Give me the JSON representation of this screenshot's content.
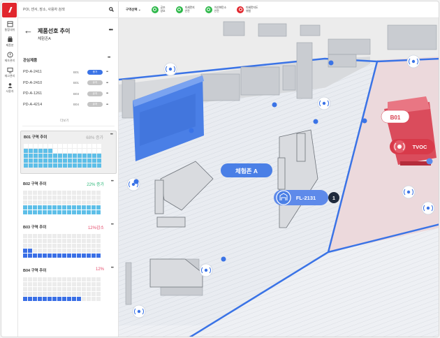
{
  "search": {
    "placeholder": "POI, 센서, 장소, 사용자 검색"
  },
  "rail": [
    {
      "name": "rail-item-dashboard",
      "icon": "dashboard-icon",
      "label": "통합대쉬"
    },
    {
      "name": "rail-item-products",
      "icon": "box-icon",
      "label": "제품분"
    },
    {
      "name": "rail-item-alerts",
      "icon": "alert-icon",
      "label": "제조관리"
    },
    {
      "name": "rail-item-monitor",
      "icon": "monitor-icon",
      "label": "재고관리"
    },
    {
      "name": "rail-item-users",
      "icon": "user-icon",
      "label": "사용자"
    }
  ],
  "header": {
    "back_icon": "arrow-left-icon",
    "title": "제품선호 추이",
    "subtitle": "체험존A"
  },
  "products": {
    "title": "관심제품",
    "items": [
      {
        "code": "PD-A-2411",
        "zone": "B01",
        "status": "증가",
        "color": "#3a73e6"
      },
      {
        "code": "PD-A-2410",
        "zone": "B01",
        "status": "유지",
        "color": "#c4c4c4"
      },
      {
        "code": "PD-A-1261",
        "zone": "B03",
        "status": "유지",
        "color": "#c4c4c4"
      },
      {
        "code": "PD-A-4214",
        "zone": "B04",
        "status": "유지",
        "color": "#c4c4c4"
      }
    ],
    "more": "더보기"
  },
  "zones": [
    {
      "title": "B01 구역 추이",
      "value": "68% 증가",
      "value_color": "#a8a8a8",
      "fill": 0.68,
      "fill_color": "#5ebfe8",
      "active": true
    },
    {
      "title": "B02 구역 추이",
      "value": "22% 증가",
      "value_color": "#2eb87a",
      "fill": 0.4,
      "fill_color": "#5ebfe8",
      "active": false
    },
    {
      "title": "B03 구역 추이",
      "value": "12%감소",
      "value_color": "#e54b6b",
      "fill": 0.22,
      "fill_color": "#3a6fe6",
      "active": false
    },
    {
      "title": "B04 구역 추이",
      "value": "12%",
      "value_color": "#e54b6b",
      "fill": 0.15,
      "fill_color": "#3a6fe6",
      "active": false
    }
  ],
  "topbar": {
    "zone_select": "구역선택",
    "status": [
      {
        "top": "공조",
        "bottom": "양호",
        "color": "#2eb84a"
      },
      {
        "top": "미세먼지",
        "bottom": "안전",
        "color": "#2eb84a"
      },
      {
        "top": "이산화탄소",
        "bottom": "안전",
        "color": "#2eb84a"
      },
      {
        "top": "미세먼지도",
        "bottom": "위험",
        "color": "#e1262d"
      }
    ]
  },
  "map": {
    "zone_label": "체험존 A",
    "b01_label": "B01",
    "tvoc_label": "TVOC",
    "forklift_label": "FL-2131",
    "forklift_count": "1"
  },
  "colors": {
    "brand": "#e1262d",
    "accent": "#3a73e6",
    "alert": "#d83a4a"
  }
}
